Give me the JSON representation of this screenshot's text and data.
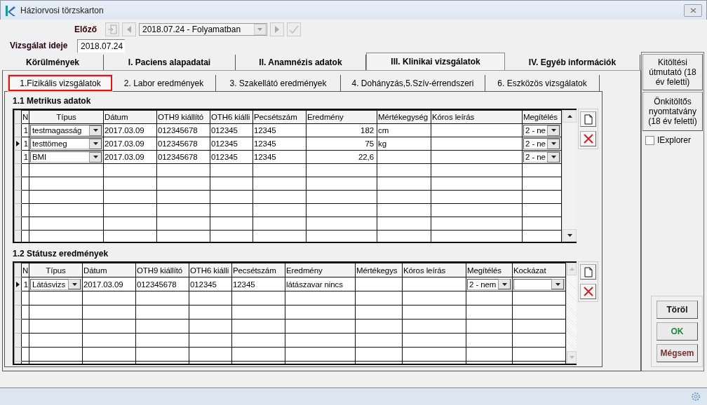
{
  "window": {
    "title": "Háziorvosi törzskarton"
  },
  "navigation": {
    "label": "Előző",
    "record": "2018.07.24 - Folyamatban"
  },
  "exam_date": {
    "label": "Vizsgálat ideje",
    "value": "2018.07.24"
  },
  "main_tabs": [
    {
      "label": "Körülmények",
      "selected": false
    },
    {
      "label": "I. Paciens alapadatai",
      "selected": false
    },
    {
      "label": "II. Anamnézis adatok",
      "selected": false
    },
    {
      "label": "III. Klinikai vizsgálatok",
      "selected": true
    },
    {
      "label": "IV. Egyéb információk",
      "selected": false
    }
  ],
  "sub_tabs": [
    {
      "label": "1.Fizikális vizsgálatok",
      "selected": true
    },
    {
      "label": "2. Labor eredmények",
      "selected": false
    },
    {
      "label": "3. Szakellátó eredmények",
      "selected": false
    },
    {
      "label": "4. Dohányzás,5.Szív-érrendszeri",
      "selected": false
    },
    {
      "label": "6. Eszközös vizsgálatok",
      "selected": false
    }
  ],
  "metric_table": {
    "title": "1.1 Metrikus adatok",
    "columns": [
      {
        "label": "N",
        "kind": "text"
      },
      {
        "label": "Típus",
        "kind": "combo"
      },
      {
        "label": "Dátum",
        "kind": "text"
      },
      {
        "label": "OTH9 kiállító",
        "kind": "text"
      },
      {
        "label": "OTH6 kiálli",
        "kind": "text"
      },
      {
        "label": "Pecsétszám",
        "kind": "text"
      },
      {
        "label": "Eredmény",
        "kind": "number"
      },
      {
        "label": "Mértékegység",
        "kind": "text"
      },
      {
        "label": "Kóros leírás",
        "kind": "text"
      },
      {
        "label": "Megítélés",
        "kind": "combo"
      }
    ],
    "rows": [
      {
        "selected": false,
        "cells": [
          "1",
          "testmagasság",
          "2017.03.09",
          "012345678",
          "012345",
          "12345",
          "182",
          "cm",
          null,
          "2 - ne"
        ]
      },
      {
        "selected": true,
        "cells": [
          "1",
          "testtömeg",
          "2017.03.09",
          "012345678",
          "012345",
          "12345",
          "75",
          "kg",
          null,
          "2 - ne"
        ]
      },
      {
        "selected": false,
        "cells": [
          "1",
          "BMI",
          "2017.03.09",
          "012345678",
          "012345",
          "12345",
          "22,6",
          null,
          null,
          "2 - ne"
        ]
      }
    ]
  },
  "status_table": {
    "title": "1.2 Státusz eredmények",
    "columns": [
      {
        "label": "N",
        "kind": "text"
      },
      {
        "label": "Típus",
        "kind": "combo"
      },
      {
        "label": "Dátum",
        "kind": "text"
      },
      {
        "label": "OTH9 kiállító",
        "kind": "text"
      },
      {
        "label": "OTH6 kiálli",
        "kind": "text"
      },
      {
        "label": "Pecsétszám",
        "kind": "text"
      },
      {
        "label": "Eredmény",
        "kind": "text"
      },
      {
        "label": "Mértékegys",
        "kind": "text"
      },
      {
        "label": "Kóros leírás",
        "kind": "text"
      },
      {
        "label": "Megítélés",
        "kind": "combo"
      },
      {
        "label": "Kockázat",
        "kind": "combo"
      }
    ],
    "rows": [
      {
        "selected": true,
        "cells": [
          "1",
          "Látásvizs",
          "2017.03.09",
          "012345678",
          "012345",
          "12345",
          "látászavar nincs",
          null,
          null,
          "2 - nem",
          null
        ]
      }
    ]
  },
  "side_buttons": [
    "Kitöltési útmutató (18 év feletti)",
    "Önkitöltős nyomtatvány (18 év feletti)"
  ],
  "iexplorer": {
    "label": "IExplorer",
    "checked": false
  },
  "actions": [
    {
      "label": "Töröl",
      "kind": "delete"
    },
    {
      "label": "OK",
      "kind": "ok"
    },
    {
      "label": "Mégsem",
      "kind": "cancel"
    }
  ]
}
